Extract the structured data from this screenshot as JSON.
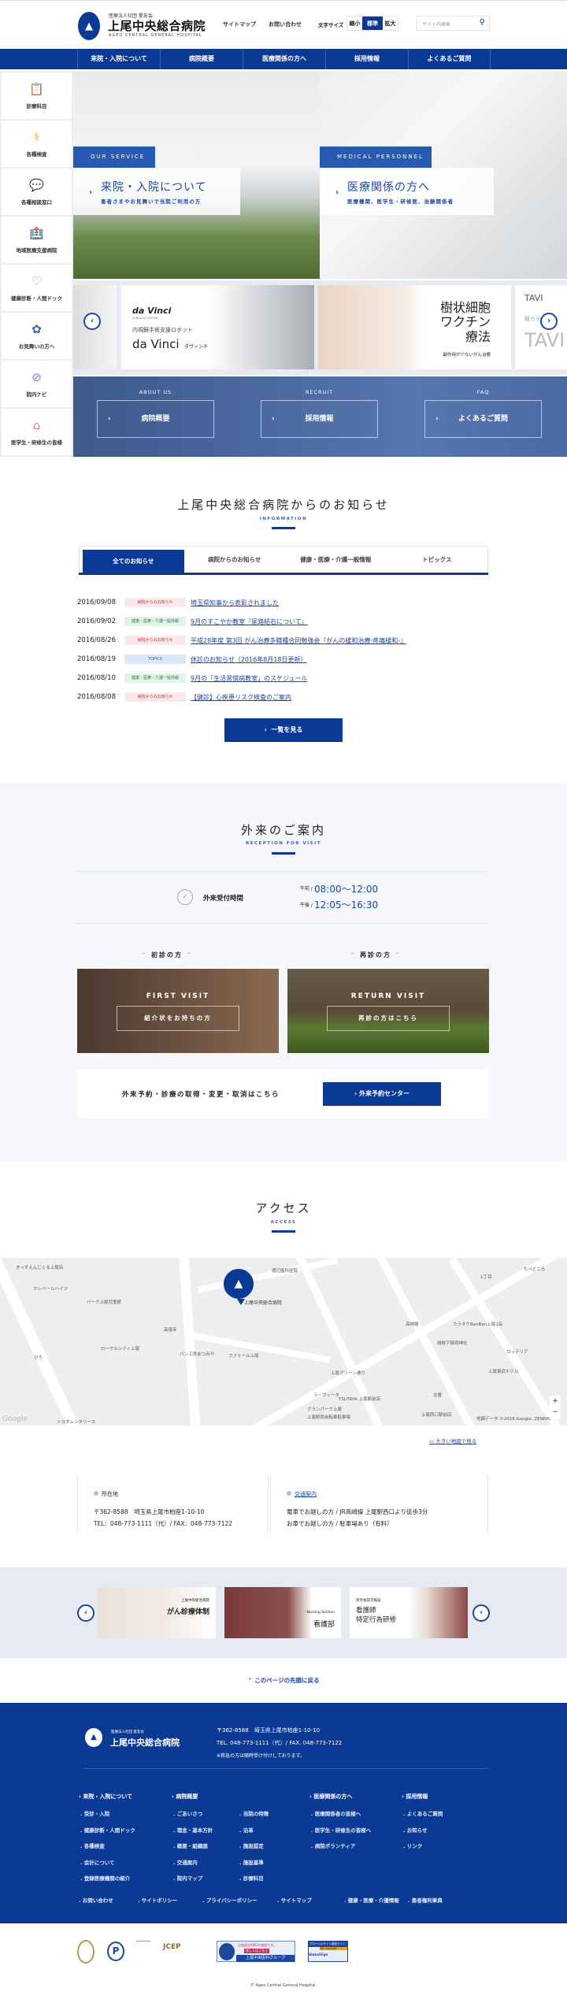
{
  "header": {
    "logo_sub": "医療法人社団 愛友会",
    "logo_name": "上尾中央総合病院",
    "logo_en": "AGEO CENTRAL GENERAL HOSPITAL",
    "links": [
      "サイトマップ",
      "お問い合わせ"
    ],
    "font_size_label": "文字サイズ",
    "font_sizes": [
      "縮小",
      "標準",
      "拡大"
    ],
    "font_size_selected": "標準",
    "search_placeholder": "サイト内検索",
    "accent": "#0a3a94"
  },
  "gnav": [
    "来院・入院について",
    "病院概要",
    "医療関係の方へ",
    "採用情報",
    "よくあるご質問"
  ],
  "sidebar": [
    {
      "label": "診療科目",
      "icon": "clipboard-icon"
    },
    {
      "label": "各種検査",
      "icon": "stethoscope-icon"
    },
    {
      "label": "各種相談窓口",
      "icon": "chat-bubble-icon"
    },
    {
      "label": "地域医療支援病院",
      "icon": "hospital-building-icon"
    },
    {
      "label": "健康診断・人間ドック",
      "icon": "heart-pulse-icon"
    },
    {
      "label": "お見舞いの方へ",
      "icon": "flower-icon"
    },
    {
      "label": "院内ナビ",
      "icon": "compass-icon"
    },
    {
      "label": "医学生・研修生の皆様",
      "icon": "graduation-cap-icon"
    }
  ],
  "hero": [
    {
      "tag": "OUR SERVICE",
      "title": "来院・入院について",
      "sub": "患者さまやお見舞いで当院ご利用の方"
    },
    {
      "tag": "MEDICAL PERSONNEL",
      "title": "医療関係の方へ",
      "sub": "医療機関、医学生・研修医、治験関係者"
    }
  ],
  "slider": {
    "davinci": {
      "brand": "da Vinci",
      "system": "SURGICAL SYSTEM",
      "caption": "内視鏡手術支援ロボット",
      "name": "da Vinci",
      "kana": "ダヴィンチ"
    },
    "vaccine": {
      "title_lines": [
        "樹状細胞",
        "ワクチン",
        "療法"
      ],
      "sub": "副作用が少ないがん治療"
    },
    "tavi": {
      "tag": "TAVI",
      "sub": "経カテーテル",
      "big": "TAVI"
    }
  },
  "banner": [
    {
      "en": "ABOUT US",
      "label": "病院概要"
    },
    {
      "en": "RECRUIT",
      "label": "採用情報"
    },
    {
      "en": "FAQ",
      "label": "よくあるご質問"
    }
  ],
  "news": {
    "title": "上尾中央総合病院からのお知らせ",
    "en": "INFORMATION",
    "tabs": [
      "全てのお知らせ",
      "病院からのお知らせ",
      "健康・医療・介護一般情報",
      "トピックス"
    ],
    "active_tab": "全てのお知らせ",
    "items": [
      {
        "date": "2016/09/08",
        "category": "病院からのお知らせ",
        "type": "red",
        "title": "埼玉県知事から表彰されました"
      },
      {
        "date": "2016/09/02",
        "category": "健康・医療・介護一般情報",
        "type": "green",
        "title": "9月のすこやか教室『尿路結石について』"
      },
      {
        "date": "2016/08/26",
        "category": "病院からのお知らせ",
        "type": "red",
        "title": "平成28年度 第3回 がん治療多職種合同勉強会『がんの緩和治療-疼痛緩和-』"
      },
      {
        "date": "2016/08/19",
        "category": "TOPICS",
        "type": "blue",
        "title": "休診のお知らせ（2016年8月18日更新）"
      },
      {
        "date": "2016/08/10",
        "category": "健康・医療・介護一般情報",
        "type": "green",
        "title": "9月の「生活習慣病教室」のスケジュール"
      },
      {
        "date": "2016/08/08",
        "category": "病院からのお知らせ",
        "type": "red",
        "title": "【健診】心疾患リスク検査のご案内"
      }
    ],
    "more_label": "一覧を見る"
  },
  "outpatient": {
    "title": "外来のご案内",
    "en": "RECEPTION FOR VISIT",
    "hours_label": "外来受付時間",
    "am_label": "午前 /",
    "am": "08:00～12:00",
    "pm_label": "午後 /",
    "pm": "12:05～16:30",
    "first": {
      "heading": "初診の方",
      "en": "FIRST VISIT",
      "label": "紹介状をお持ちの方"
    },
    "return": {
      "heading": "再診の方",
      "en": "RETURN VISIT",
      "label": "再診の方はこちら"
    },
    "reserve_text": "外来予約・診療の取得・変更・取消はこちら",
    "reserve_button": "外来予約センター"
  },
  "access": {
    "title": "アクセス",
    "en": "ACCESS",
    "map_labels": [
      "きっずえんじぇる上尾店",
      "クレベールハイツ",
      "パーク上尾児童館",
      "上尾中央総合病院",
      "渡辺歯科医院",
      "高徳寺",
      "パン工房あつみや",
      "ファミール上尾",
      "ローヤルシティ上尾",
      "ひろ",
      "トヨタレンタリース",
      "ラ・ヴィータ",
      "TSUTAYA 上尾駅前店",
      "グランパーク上尾",
      "上尾駅西自転車駐車場",
      "上尾グリーン通り",
      "カラオケBanBan上尾1店",
      "胡桃下稲荷神社",
      "ロッテリア",
      "上尾東武ホテル",
      "交番",
      "上尾西口駅前店",
      "たべどころ",
      "1丁目",
      "高崎線",
      "Google",
      "地図データ ©2016 Google, ZENRIN"
    ],
    "big_map": "大きい地図で見る",
    "location_label": "所在地",
    "address": "〒362-8588　埼玉県上尾市柏座1-10-10",
    "tel": "TEL：048-773-1111（代）/ FAX：048-773-7122",
    "traffic_label": "交通案内",
    "train": "電車でお越しの方 / JR高崎線 上尾駅西口より徒歩3分",
    "car": "お車でお越しの方 / 駐車場あり（有料）"
  },
  "banners2": [
    {
      "sub": "上尾中央総合病院",
      "title": "がん診療体制"
    },
    {
      "sub": "Nursing Section",
      "title": "看護部"
    },
    {
      "sub": "厚労省認可施設",
      "title_lines": [
        "看護師",
        "特定行為研修"
      ]
    }
  ],
  "back_to_top": "このページの先頭に戻る",
  "footer": {
    "logo_sub": "医療法人社団 愛友会",
    "logo_name": "上尾中央総合病院",
    "address": "〒362-8588　埼玉県上尾市柏座1-10-10",
    "tel": "TEL. 048-773-1111（代）/ FAX. 048-773-7122",
    "note": "※救急の方は随時受け付けしております。",
    "cols": [
      {
        "title": "来院・入院について",
        "items": [
          "受診・入院",
          "健康診断・人間ドック",
          "各種検査",
          "会計について",
          "登録医療機関の紹介"
        ]
      },
      {
        "title": "病院概要",
        "items": [
          "ごあいさつ",
          "理念・基本方針",
          "概要・組織図",
          "交通案内",
          "院内マップ"
        ]
      },
      {
        "title": "",
        "items": [
          "当院の特徴",
          "沿革",
          "施設認定",
          "施設基準",
          "診療科目"
        ]
      },
      {
        "title": "医療関係の方へ",
        "items": [
          "医療関係者の皆様へ",
          "医学生・研修生の皆様へ",
          "病院ボランティア"
        ]
      },
      {
        "title": "採用情報",
        "items": [
          "よくあるご質問",
          "お知らせ",
          "リンク"
        ]
      }
    ],
    "bottom_links": [
      "お問い合わせ",
      "サイトポリシー",
      "プライバシーポリシー",
      "サイトマップ",
      "健康・医療・介護情報",
      "患者権利章典"
    ]
  },
  "badges": [
    "JCEP",
    "当施設はAMGの施設です。",
    "詳しくはこちら",
    "上尾中央医科グループ",
    "グローバルサイン認証サイト",
    "SSL secured",
    "GlobalSign"
  ],
  "copyright": "© Ageo Central General Hospital."
}
